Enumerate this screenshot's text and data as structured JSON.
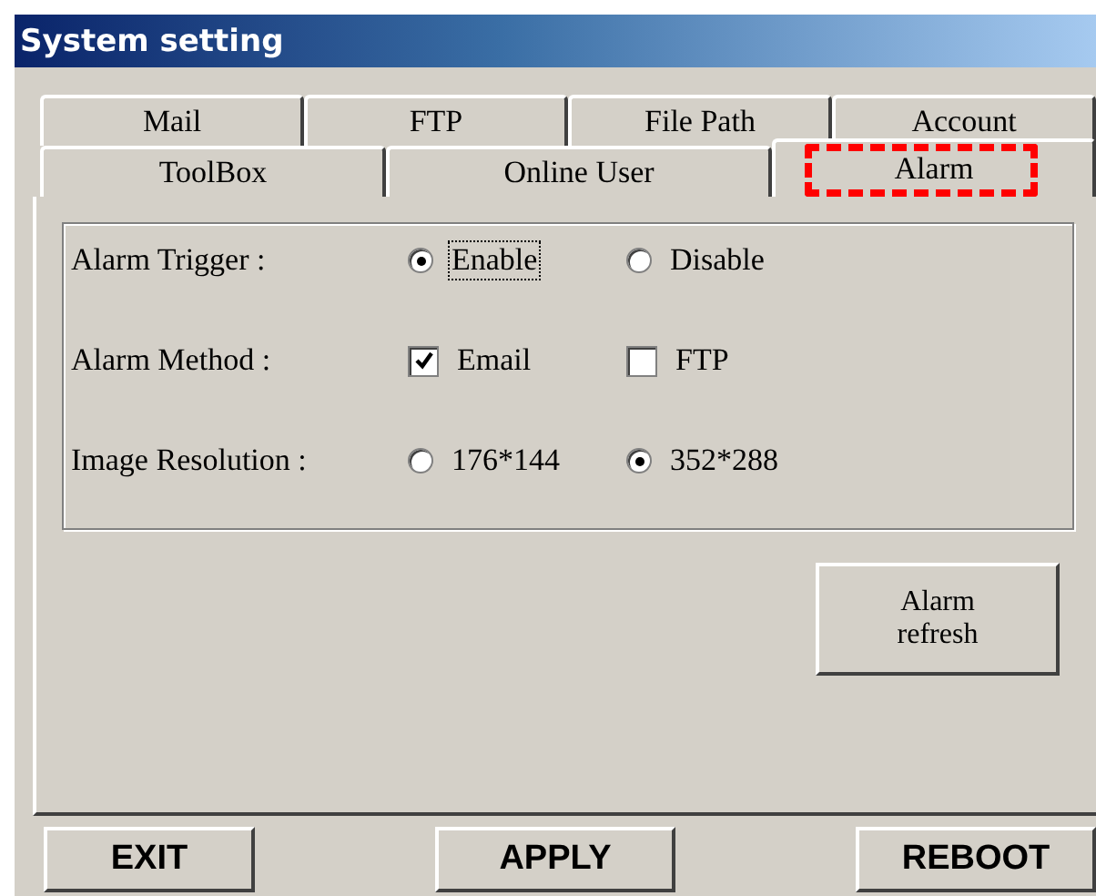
{
  "window": {
    "title": "System setting"
  },
  "tab_rows": [
    [
      {
        "label": "Mail",
        "selected": false,
        "highlighted": false
      },
      {
        "label": "FTP",
        "selected": false,
        "highlighted": false
      },
      {
        "label": "File Path",
        "selected": false,
        "highlighted": false
      },
      {
        "label": "Account",
        "selected": false,
        "highlighted": false
      }
    ],
    [
      {
        "label": "ToolBox",
        "selected": false,
        "highlighted": false
      },
      {
        "label": "Online User",
        "selected": false,
        "highlighted": false
      },
      {
        "label": "Alarm",
        "selected": true,
        "highlighted": true
      }
    ]
  ],
  "settings": [
    {
      "label": "Alarm Trigger :",
      "kind": "radio",
      "options": [
        {
          "label": "Enable",
          "selected": true,
          "focused": true
        },
        {
          "label": "Disable",
          "selected": false,
          "focused": false
        }
      ]
    },
    {
      "label": "Alarm Method :",
      "kind": "checkbox",
      "options": [
        {
          "label": "Email",
          "checked": true
        },
        {
          "label": "FTP",
          "checked": false
        }
      ]
    },
    {
      "label": "Image Resolution :",
      "kind": "radio",
      "options": [
        {
          "label": "176*144",
          "selected": false,
          "focused": false
        },
        {
          "label": "352*288",
          "selected": true,
          "focused": false
        }
      ]
    }
  ],
  "refresh_button": {
    "label": "Alarm\nrefresh"
  },
  "buttons": [
    "EXIT",
    "APPLY",
    "REBOOT"
  ]
}
